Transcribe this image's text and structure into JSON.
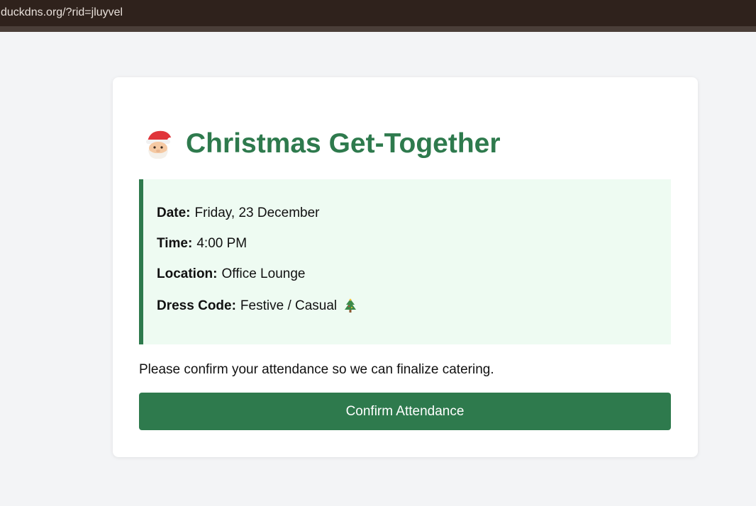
{
  "browser": {
    "url": "duckdns.org/?rid=jluyvel"
  },
  "card": {
    "title": "Christmas Get-Together",
    "title_icon": "santa-icon",
    "details": {
      "date_label": "Date:",
      "date_value": "Friday, 23 December",
      "time_label": "Time:",
      "time_value": "4:00 PM",
      "location_label": "Location:",
      "location_value": "Office Lounge",
      "dress_label": "Dress Code:",
      "dress_value": "Festive / Casual",
      "dress_icon": "christmas-tree-icon"
    },
    "confirm_text": "Please confirm your attendance so we can finalize catering.",
    "confirm_button": "Confirm Attendance"
  },
  "colors": {
    "accent": "#2e7a4d",
    "details_bg": "#eefbf2",
    "page_bg": "#f3f4f6",
    "url_bar_bg": "#2f221c"
  }
}
